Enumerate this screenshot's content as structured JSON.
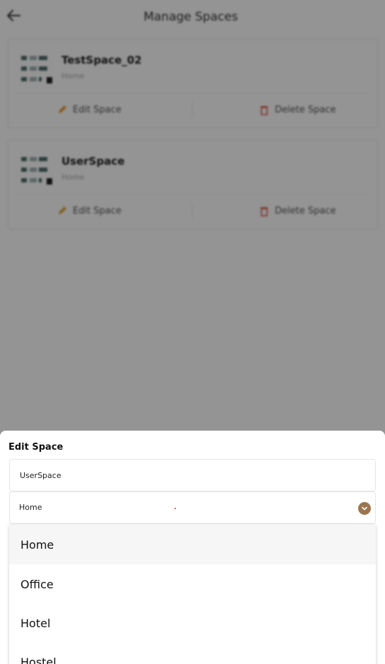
{
  "header": {
    "title": "Manage Spaces"
  },
  "spaces": [
    {
      "name": "TestSpace_02",
      "type": "Home",
      "edit_label": "Edit Space",
      "delete_label": "Delete Space"
    },
    {
      "name": "UserSpace",
      "type": "Home",
      "edit_label": "Edit Space",
      "delete_label": "Delete Space"
    }
  ],
  "edit_sheet": {
    "title": "Edit Space",
    "name_value": "UserSpace",
    "type_value": "Home",
    "options": [
      "Home",
      "Office",
      "Hotel",
      "Hostel"
    ],
    "selected_option": "Home"
  },
  "colors": {
    "accent": "#9a7650",
    "delete_red": "#e05a4e",
    "edit_orange": "#e8a33a"
  },
  "icons": {
    "back": "arrow-left-icon",
    "edit": "pencil-icon",
    "delete": "trash-icon",
    "dropdown": "chevron-down-icon",
    "thumb": "space-grid-icon"
  }
}
